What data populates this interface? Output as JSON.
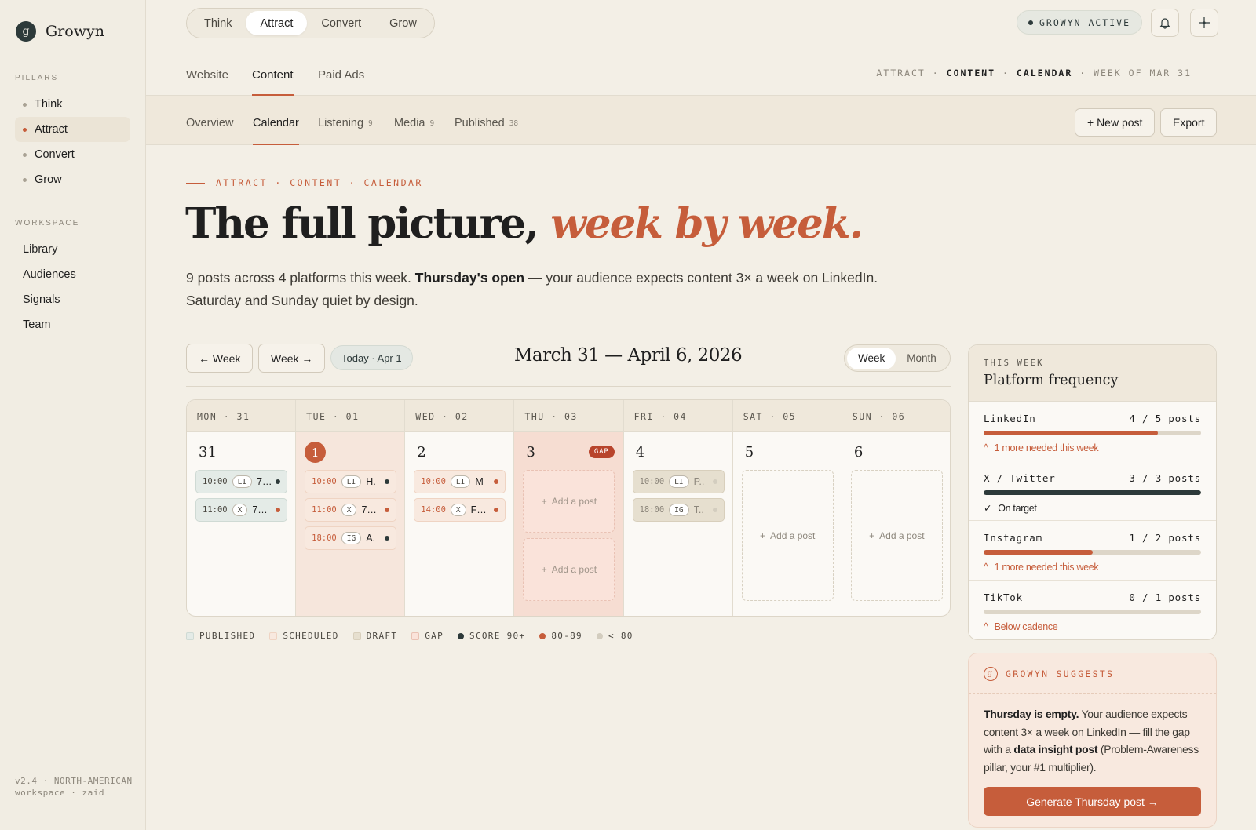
{
  "brand": {
    "mark": "g",
    "name": "Growyn"
  },
  "sidebar": {
    "pillars_label": "PILLARS",
    "pillars": [
      {
        "label": "Think",
        "active": false
      },
      {
        "label": "Attract",
        "active": true
      },
      {
        "label": "Convert",
        "active": false
      },
      {
        "label": "Grow",
        "active": false
      }
    ],
    "workspace_label": "WORKSPACE",
    "workspace": [
      {
        "label": "Library"
      },
      {
        "label": "Audiences"
      },
      {
        "label": "Signals"
      },
      {
        "label": "Team"
      }
    ],
    "footer": "v2.4 · NORTH-AMERICAN workspace · zaid"
  },
  "topbar": {
    "pillar_tabs": [
      "Think",
      "Attract",
      "Convert",
      "Grow"
    ],
    "active_pillar": "Attract",
    "status": "GROWYN ACTIVE"
  },
  "subnav": {
    "tabs": [
      "Website",
      "Content",
      "Paid Ads"
    ],
    "active": "Content",
    "crumb_1": "ATTRACT",
    "crumb_2": "CONTENT",
    "crumb_3": "CALENDAR",
    "crumb_4": "WEEK OF MAR 31",
    "sep": " · "
  },
  "tertnav": {
    "tabs": [
      {
        "label": "Overview",
        "count": ""
      },
      {
        "label": "Calendar",
        "count": ""
      },
      {
        "label": "Listening",
        "count": "9"
      },
      {
        "label": "Media",
        "count": "9"
      },
      {
        "label": "Published",
        "count": "38"
      }
    ],
    "active": "Calendar",
    "new_post": "+ New post",
    "export": "Export"
  },
  "hero": {
    "eyebrow": "ATTRACT · CONTENT · CALENDAR",
    "title_plain": "The full picture,",
    "title_accent": "week by week.",
    "sub_1": "9 posts across 4 platforms this week.",
    "sub_bold": "Thursday's open",
    "sub_2": "— your audience expects content 3× a week on LinkedIn. Saturday and Sunday quiet by design."
  },
  "controls": {
    "prev": "← Week",
    "next": "Week →",
    "today": "Today · Apr 1",
    "range": "March 31 — April 6, 2026",
    "view_week": "Week",
    "view_month": "Month"
  },
  "calendar": {
    "add_label": "Add a post",
    "gap_label": "GAP",
    "days": [
      {
        "head": "MON · 31",
        "num": "31",
        "today": false,
        "gap": false,
        "posts": [
          {
            "time": "10:00",
            "platform": "LI",
            "title": "7…",
            "status": "published",
            "score": "90+"
          },
          {
            "time": "11:00",
            "platform": "X",
            "title": "7…",
            "status": "published",
            "score": "80-89"
          }
        ]
      },
      {
        "head": "TUE · 01",
        "num": "1",
        "today": true,
        "gap": false,
        "posts": [
          {
            "time": "10:00",
            "platform": "LI",
            "title": "H.",
            "status": "scheduled",
            "score": "90+"
          },
          {
            "time": "11:00",
            "platform": "X",
            "title": "7…",
            "status": "scheduled",
            "score": "80-89"
          },
          {
            "time": "18:00",
            "platform": "IG",
            "title": "A.",
            "status": "scheduled",
            "score": "90+"
          }
        ]
      },
      {
        "head": "WED · 02",
        "num": "2",
        "today": false,
        "gap": false,
        "posts": [
          {
            "time": "10:00",
            "platform": "LI",
            "title": "M",
            "status": "scheduled",
            "score": "80-89"
          },
          {
            "time": "14:00",
            "platform": "X",
            "title": "F…",
            "status": "scheduled",
            "score": "80-89"
          }
        ]
      },
      {
        "head": "THU · 03",
        "num": "3",
        "today": false,
        "gap": true,
        "posts": []
      },
      {
        "head": "FRI · 04",
        "num": "4",
        "today": false,
        "gap": false,
        "posts": [
          {
            "time": "10:00",
            "platform": "LI",
            "title": "P..",
            "status": "draft",
            "score": "<80"
          },
          {
            "time": "18:00",
            "platform": "IG",
            "title": "T..",
            "status": "draft",
            "score": "<80"
          }
        ]
      },
      {
        "head": "SAT · 05",
        "num": "5",
        "today": false,
        "gap": false,
        "posts": []
      },
      {
        "head": "SUN · 06",
        "num": "6",
        "today": false,
        "gap": false,
        "posts": []
      }
    ]
  },
  "legend": {
    "published": "PUBLISHED",
    "scheduled": "SCHEDULED",
    "draft": "DRAFT",
    "gap": "GAP",
    "score_high": "SCORE 90+",
    "score_mid": "80-89",
    "score_low": "< 80"
  },
  "colors": {
    "accent": "#c65d3b",
    "dark": "#2d3a3a",
    "score_high": "#2d3a3a",
    "score_mid": "#c65d3b",
    "score_low": "#d3cdbf"
  },
  "frequency": {
    "eyebrow": "THIS WEEK",
    "title": "Platform frequency",
    "rows": [
      {
        "name": "LinkedIn",
        "count": "4 / 5 posts",
        "ratio": 0.8,
        "note": "1 more needed this week",
        "state": "under"
      },
      {
        "name": "X / Twitter",
        "count": "3 / 3 posts",
        "ratio": 1.0,
        "note": "On target",
        "state": "ok"
      },
      {
        "name": "Instagram",
        "count": "1 / 2 posts",
        "ratio": 0.5,
        "note": "1 more needed this week",
        "state": "under"
      },
      {
        "name": "TikTok",
        "count": "0 / 1 posts",
        "ratio": 0.0,
        "note": "Below cadence",
        "state": "under"
      }
    ]
  },
  "suggest": {
    "icon": "g",
    "label": "GROWYN SUGGESTS",
    "b1": "Thursday is empty.",
    "t1": " Your audience expects content 3× a week on LinkedIn — fill the gap with a ",
    "b2": "data insight post",
    "t2": " (Problem-Awareness pillar, your #1 multiplier).",
    "button": "Generate Thursday post →"
  }
}
